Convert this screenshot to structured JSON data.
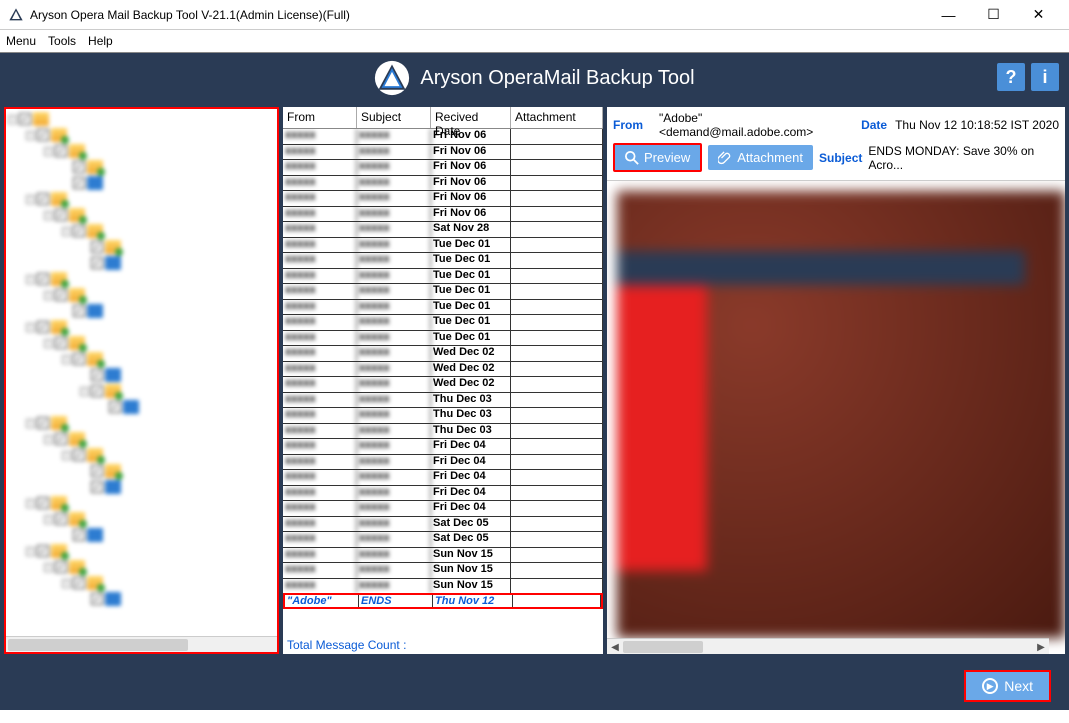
{
  "window": {
    "title": "Aryson Opera Mail Backup Tool V-21.1(Admin License)(Full)"
  },
  "menu": {
    "items": [
      "Menu",
      "Tools",
      "Help"
    ]
  },
  "banner": {
    "title": "Aryson OperaMail Backup Tool"
  },
  "list": {
    "headers": {
      "from": "From",
      "subject": "Subject",
      "date": "Recived Date",
      "attachment": "Attachment"
    },
    "rows": [
      {
        "date": "Fri Nov 06"
      },
      {
        "date": "Fri Nov 06"
      },
      {
        "date": "Fri Nov 06"
      },
      {
        "date": "Fri Nov 06"
      },
      {
        "date": "Fri Nov 06"
      },
      {
        "date": "Fri Nov 06"
      },
      {
        "date": "Sat Nov 28"
      },
      {
        "date": "Tue Dec 01"
      },
      {
        "date": "Tue Dec 01"
      },
      {
        "date": "Tue Dec 01"
      },
      {
        "date": "Tue Dec 01"
      },
      {
        "date": "Tue Dec 01"
      },
      {
        "date": "Tue Dec 01"
      },
      {
        "date": "Tue Dec 01"
      },
      {
        "date": "Wed Dec 02"
      },
      {
        "date": "Wed Dec 02"
      },
      {
        "date": "Wed Dec 02"
      },
      {
        "date": "Thu Dec 03"
      },
      {
        "date": "Thu Dec 03"
      },
      {
        "date": "Thu Dec 03"
      },
      {
        "date": "Fri Dec 04"
      },
      {
        "date": "Fri Dec 04"
      },
      {
        "date": "Fri Dec 04"
      },
      {
        "date": "Fri Dec 04"
      },
      {
        "date": "Fri Dec 04"
      },
      {
        "date": "Sat Dec 05"
      },
      {
        "date": "Sat Dec 05"
      },
      {
        "date": "Sun Nov 15"
      },
      {
        "date": "Sun Nov 15"
      },
      {
        "date": "Sun Nov 15"
      }
    ],
    "selected": {
      "from": "\"Adobe\"",
      "subject": "ENDS",
      "date": "Thu Nov 12"
    },
    "footer": "Total Message Count :"
  },
  "preview": {
    "from_label": "From",
    "from_value": "\"Adobe\" <demand@mail.adobe.com>",
    "date_label": "Date",
    "date_value": "Thu Nov 12 10:18:52 IST 2020",
    "subject_label": "Subject",
    "subject_value": "ENDS MONDAY: Save 30% on Acro...",
    "tab_preview": "Preview",
    "tab_attachment": "Attachment"
  },
  "footer": {
    "next": "Next"
  },
  "tree": {
    "rows": [
      {
        "indent": 0,
        "exp": "-",
        "icon": "yellow"
      },
      {
        "indent": 1,
        "exp": "-",
        "icon": "green"
      },
      {
        "indent": 2,
        "exp": "-",
        "icon": "green"
      },
      {
        "indent": 3,
        "exp": "",
        "icon": "green"
      },
      {
        "indent": 3,
        "exp": "",
        "icon": "blue"
      },
      {
        "indent": 1,
        "exp": "-",
        "icon": "green"
      },
      {
        "indent": 2,
        "exp": "-",
        "icon": "green"
      },
      {
        "indent": 3,
        "exp": "-",
        "icon": "green"
      },
      {
        "indent": 4,
        "exp": "",
        "icon": "green"
      },
      {
        "indent": 4,
        "exp": "",
        "icon": "blue"
      },
      {
        "indent": 1,
        "exp": "-",
        "icon": "green"
      },
      {
        "indent": 2,
        "exp": "-",
        "icon": "green"
      },
      {
        "indent": 3,
        "exp": "",
        "icon": "blue"
      },
      {
        "indent": 1,
        "exp": "-",
        "icon": "green"
      },
      {
        "indent": 2,
        "exp": "-",
        "icon": "green"
      },
      {
        "indent": 3,
        "exp": "-",
        "icon": "green"
      },
      {
        "indent": 4,
        "exp": "",
        "icon": "blue"
      },
      {
        "indent": 4,
        "exp": "-",
        "icon": "green"
      },
      {
        "indent": 5,
        "exp": "",
        "icon": "blue"
      },
      {
        "indent": 1,
        "exp": "-",
        "icon": "green"
      },
      {
        "indent": 2,
        "exp": "-",
        "icon": "green"
      },
      {
        "indent": 3,
        "exp": "-",
        "icon": "green"
      },
      {
        "indent": 4,
        "exp": "",
        "icon": "green"
      },
      {
        "indent": 4,
        "exp": "",
        "icon": "blue"
      },
      {
        "indent": 1,
        "exp": "-",
        "icon": "green"
      },
      {
        "indent": 2,
        "exp": "-",
        "icon": "green"
      },
      {
        "indent": 3,
        "exp": "",
        "icon": "blue"
      },
      {
        "indent": 1,
        "exp": "-",
        "icon": "green"
      },
      {
        "indent": 2,
        "exp": "-",
        "icon": "green"
      },
      {
        "indent": 3,
        "exp": "-",
        "icon": "green"
      },
      {
        "indent": 4,
        "exp": "",
        "icon": "blue"
      }
    ]
  }
}
